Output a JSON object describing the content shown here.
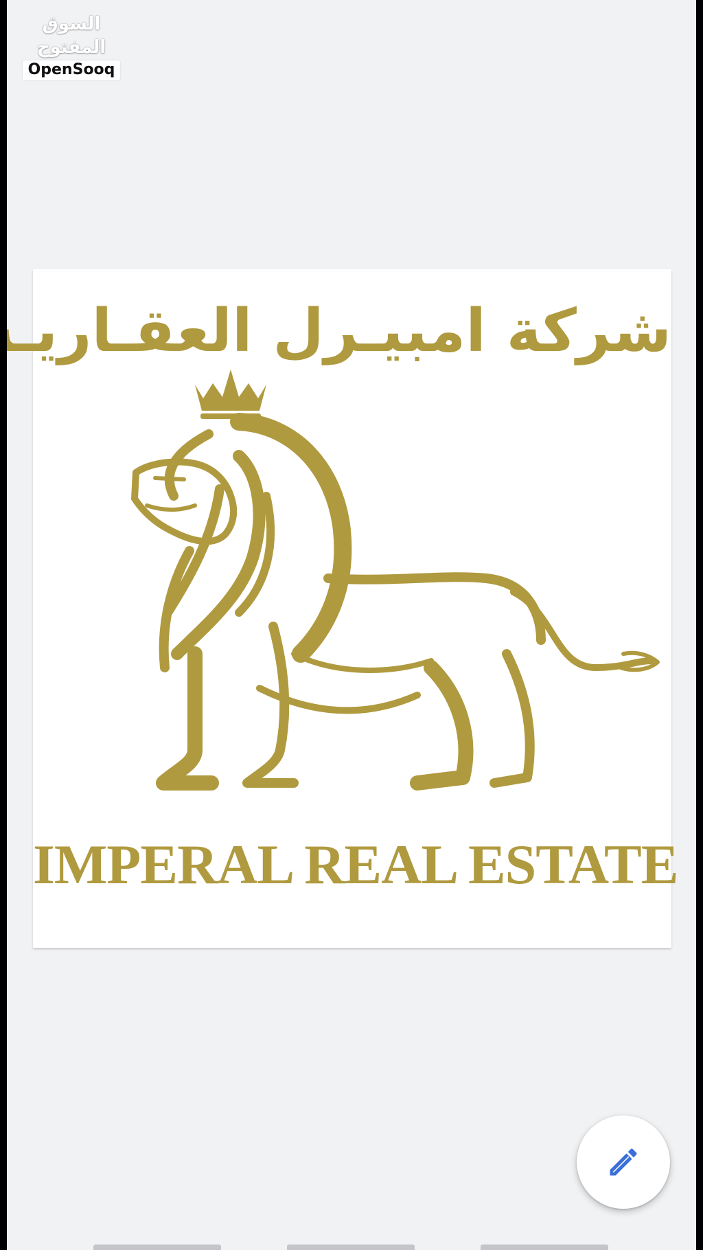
{
  "watermark": {
    "arabic": "السوق المفتوح",
    "latin": "OpenSooq"
  },
  "logo": {
    "arabic_name": "شركة امبيـرل العقـاريـة",
    "english_name": "IMPERAL REAL ESTATE",
    "brand_color": "#b09a3f",
    "emblem": "crowned-lion-icon"
  },
  "fab": {
    "icon": "pencil-icon",
    "icon_color": "#3b6fd8"
  },
  "colors": {
    "background": "#f1f2f4",
    "card": "#ffffff",
    "pager": "#c3c5c9"
  }
}
